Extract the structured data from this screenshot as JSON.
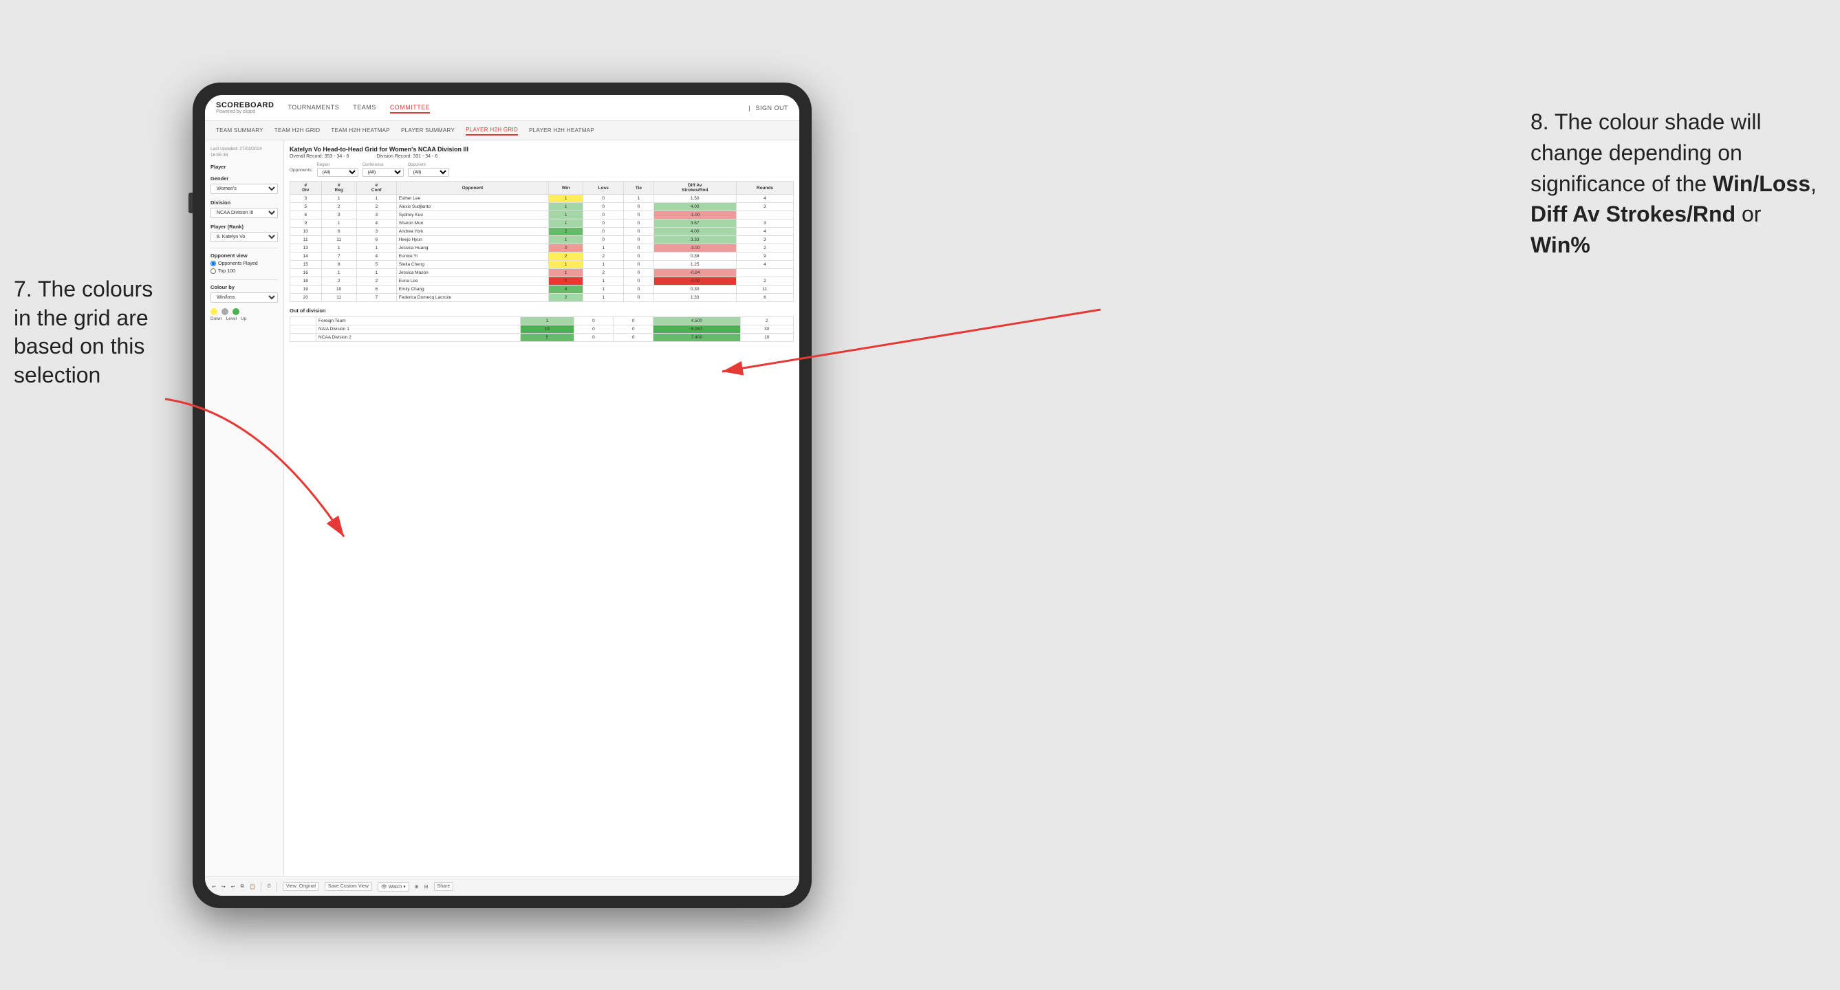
{
  "annotations": {
    "left": "7. The colours in the grid are based on this selection",
    "right_prefix": "8. The colour shade will change depending on significance of the ",
    "right_bold1": "Win/Loss",
    "right_comma": ", ",
    "right_bold2": "Diff Av Strokes/Rnd",
    "right_or": " or ",
    "right_bold3": "Win%"
  },
  "nav": {
    "logo": "SCOREBOARD",
    "logo_sub": "Powered by clippd",
    "items": [
      "TOURNAMENTS",
      "TEAMS",
      "COMMITTEE"
    ],
    "sign_in": "Sign out"
  },
  "sub_nav": {
    "items": [
      "TEAM SUMMARY",
      "TEAM H2H GRID",
      "TEAM H2H HEATMAP",
      "PLAYER SUMMARY",
      "PLAYER H2H GRID",
      "PLAYER H2H HEATMAP"
    ]
  },
  "sidebar": {
    "last_updated_label": "Last Updated: 27/03/2024",
    "last_updated_time": "16:55:38",
    "player_label": "Player",
    "gender_label": "Gender",
    "gender_value": "Women's",
    "division_label": "Division",
    "division_value": "NCAA Division III",
    "player_rank_label": "Player (Rank)",
    "player_rank_value": "8. Katelyn Vo",
    "opponent_view_label": "Opponent view",
    "radio1": "Opponents Played",
    "radio2": "Top 100",
    "colour_by_label": "Colour by",
    "colour_by_value": "Win/loss",
    "legend": {
      "down_label": "Down",
      "level_label": "Level",
      "up_label": "Up"
    }
  },
  "grid": {
    "title": "Katelyn Vo Head-to-Head Grid for Women's NCAA Division III",
    "overall_record_label": "Overall Record:",
    "overall_record_value": "353 - 34 - 6",
    "division_record_label": "Division Record:",
    "division_record_value": "331 - 34 - 6",
    "filters": {
      "region_label": "Region",
      "region_value": "(All)",
      "conference_label": "Conference",
      "conference_value": "(All)",
      "opponent_label": "Opponent",
      "opponent_value": "(All)"
    },
    "table_headers": [
      "#\nDiv",
      "#\nReg",
      "#\nConf",
      "Opponent",
      "Win",
      "Loss",
      "Tie",
      "Diff Av\nStrokes/Rnd",
      "Rounds"
    ],
    "rows": [
      {
        "div": "3",
        "reg": "1",
        "conf": "1",
        "opponent": "Esther Lee",
        "win": "1",
        "loss": "0",
        "tie": "1",
        "diff": "1.50",
        "rounds": "4",
        "win_class": "cell-yellow",
        "diff_class": ""
      },
      {
        "div": "5",
        "reg": "2",
        "conf": "2",
        "opponent": "Alexis Sudjianto",
        "win": "1",
        "loss": "0",
        "tie": "0",
        "diff": "4.00",
        "rounds": "3",
        "win_class": "cell-green-light",
        "diff_class": "cell-green-light"
      },
      {
        "div": "6",
        "reg": "3",
        "conf": "3",
        "opponent": "Sydney Kuo",
        "win": "1",
        "loss": "0",
        "tie": "0",
        "diff": "-1.00",
        "rounds": "",
        "win_class": "cell-green-light",
        "diff_class": "cell-red-light"
      },
      {
        "div": "9",
        "reg": "1",
        "conf": "4",
        "opponent": "Sharon Mun",
        "win": "1",
        "loss": "0",
        "tie": "0",
        "diff": "3.67",
        "rounds": "3",
        "win_class": "cell-green-light",
        "diff_class": "cell-green-light"
      },
      {
        "div": "10",
        "reg": "6",
        "conf": "3",
        "opponent": "Andrea York",
        "win": "2",
        "loss": "0",
        "tie": "0",
        "diff": "4.00",
        "rounds": "4",
        "win_class": "cell-green-med",
        "diff_class": "cell-green-light"
      },
      {
        "div": "11",
        "reg": "11",
        "conf": "6",
        "opponent": "Heejo Hyun",
        "win": "1",
        "loss": "0",
        "tie": "0",
        "diff": "3.33",
        "rounds": "3",
        "win_class": "cell-green-light",
        "diff_class": "cell-green-light"
      },
      {
        "div": "13",
        "reg": "1",
        "conf": "1",
        "opponent": "Jessica Huang",
        "win": "0",
        "loss": "1",
        "tie": "0",
        "diff": "-3.00",
        "rounds": "2",
        "win_class": "cell-red-light",
        "diff_class": "cell-red-light"
      },
      {
        "div": "14",
        "reg": "7",
        "conf": "4",
        "opponent": "Eunice Yi",
        "win": "2",
        "loss": "2",
        "tie": "0",
        "diff": "0.38",
        "rounds": "9",
        "win_class": "cell-yellow",
        "diff_class": ""
      },
      {
        "div": "15",
        "reg": "8",
        "conf": "5",
        "opponent": "Stella Cheng",
        "win": "1",
        "loss": "1",
        "tie": "0",
        "diff": "1.25",
        "rounds": "4",
        "win_class": "cell-yellow",
        "diff_class": ""
      },
      {
        "div": "16",
        "reg": "1",
        "conf": "1",
        "opponent": "Jessica Mason",
        "win": "1",
        "loss": "2",
        "tie": "0",
        "diff": "-0.94",
        "rounds": "",
        "win_class": "cell-red-light",
        "diff_class": "cell-red-light"
      },
      {
        "div": "18",
        "reg": "2",
        "conf": "2",
        "opponent": "Euna Lee",
        "win": "0",
        "loss": "1",
        "tie": "0",
        "diff": "-5.00",
        "rounds": "2",
        "win_class": "cell-red-dark",
        "diff_class": "cell-red-dark"
      },
      {
        "div": "19",
        "reg": "10",
        "conf": "6",
        "opponent": "Emily Chang",
        "win": "4",
        "loss": "1",
        "tie": "0",
        "diff": "0.30",
        "rounds": "11",
        "win_class": "cell-green-med",
        "diff_class": ""
      },
      {
        "div": "20",
        "reg": "11",
        "conf": "7",
        "opponent": "Federica Domecq Lacroze",
        "win": "2",
        "loss": "1",
        "tie": "0",
        "diff": "1.33",
        "rounds": "6",
        "win_class": "cell-green-light",
        "diff_class": ""
      }
    ],
    "out_of_division_header": "Out of division",
    "out_of_division_rows": [
      {
        "name": "Foreign Team",
        "win": "1",
        "loss": "0",
        "tie": "0",
        "diff": "4.500",
        "rounds": "2",
        "win_class": "cell-green-light",
        "diff_class": "cell-green-light"
      },
      {
        "name": "NAIA Division 1",
        "win": "15",
        "loss": "0",
        "tie": "0",
        "diff": "9.267",
        "rounds": "30",
        "win_class": "cell-green-dark",
        "diff_class": "cell-green-dark"
      },
      {
        "name": "NCAA Division 2",
        "win": "5",
        "loss": "0",
        "tie": "0",
        "diff": "7.400",
        "rounds": "10",
        "win_class": "cell-green-med",
        "diff_class": "cell-green-med"
      }
    ]
  },
  "toolbar": {
    "view_original": "View: Original",
    "save_custom": "Save Custom View",
    "watch": "Watch",
    "share": "Share"
  }
}
